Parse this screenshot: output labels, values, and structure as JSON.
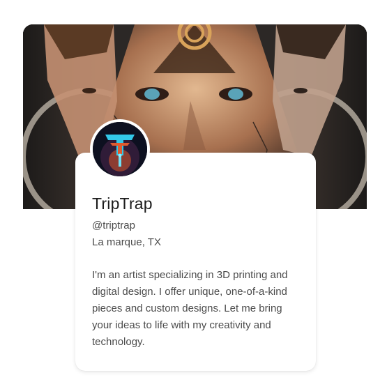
{
  "profile": {
    "name": "TripTrap",
    "handle": "@triptrap",
    "location": "La marque, TX",
    "bio": "I'm an artist specializing in 3D printing and digital design. I offer unique, one-of-a-kind pieces and custom designs. Let me bring your ideas to life with my creativity and technology.",
    "cover_image": "surreal-faces-triangle-artwork",
    "avatar_image": "triptrap-logo-figure"
  },
  "colors": {
    "card_background": "#ffffff",
    "name_text": "#1c1c1c",
    "secondary_text": "#4b4b4b"
  }
}
